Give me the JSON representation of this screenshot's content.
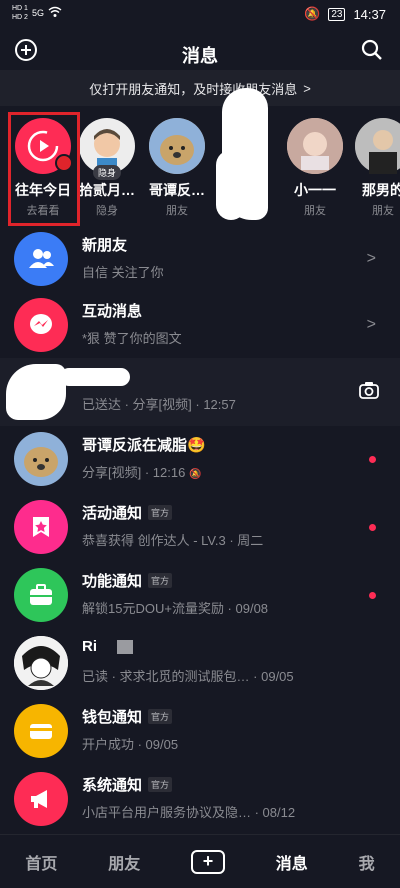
{
  "status_bar": {
    "network_left": [
      "HD 1",
      "HD 2"
    ],
    "signal": "5G",
    "time": "14:37",
    "battery": "23"
  },
  "header": {
    "title": "消息",
    "add_icon": "plus-circle-icon",
    "search_icon": "search-icon"
  },
  "banner": {
    "text": "仅打开朋友通知，及时接收朋友消息",
    "chevron": ">"
  },
  "stories": [
    {
      "name": "往年今日",
      "sub": "去看看",
      "avatar_color": "#fe2c55"
    },
    {
      "name": "拾贰月…",
      "sub": "隐身",
      "tag": "隐身",
      "avatar_color": "#ededed"
    },
    {
      "name": "哥谭反…",
      "sub": "朋友",
      "avatar_color": "#b99a6f"
    },
    {
      "name": "",
      "sub": "",
      "avatar_color": "#ffffff"
    },
    {
      "name": "小一一",
      "sub": "朋友",
      "avatar_color": "#d9b7b0"
    },
    {
      "name": "那男的",
      "sub": "朋友",
      "avatar_color": "#3a3a3a"
    }
  ],
  "list": [
    {
      "title": "新朋友",
      "subtitle": "自信 关注了你",
      "right": ">",
      "icon": "people-icon",
      "color": "#3b7cf6"
    },
    {
      "title": "互动消息",
      "subtitle": "*狠 赞了你的图文",
      "right": ">",
      "icon": "chat-bolt-icon",
      "color": "#fe2c55"
    },
    {
      "title": "",
      "subtitle": "已送达 · 分享[视频] · 12:57",
      "right": "camera",
      "icon": "redacted",
      "color": "#ffffff"
    },
    {
      "title": "哥谭反派在减脂🤩",
      "subtitle": "分享[视频] · 12:16",
      "right": "dot",
      "icon": "dog-avatar",
      "color": "#b99a6f"
    },
    {
      "title": "活动通知",
      "subtitle": "恭喜获得  创作达人 - LV.3 · 周二",
      "official": "官方",
      "right": "dot",
      "icon": "star-bookmark-icon",
      "color": "#fe2c8d"
    },
    {
      "title": "功能通知",
      "subtitle": "解锁15元DOU+流量奖励 · 09/08",
      "official": "官方",
      "right": "dot",
      "icon": "briefcase-icon",
      "color": "#2ec65a"
    },
    {
      "title": "Ri",
      "subtitle": "已读 · 求求北觅的测试服包… · 09/05",
      "right": "",
      "icon": "anime-avatar",
      "color": "#ffffff"
    },
    {
      "title": "钱包通知",
      "subtitle": "开户成功 · 09/05",
      "official": "官方",
      "right": "",
      "icon": "wallet-icon",
      "color": "#f7b500"
    },
    {
      "title": "系统通知",
      "subtitle": "小店平台用户服务协议及隐… · 08/12",
      "official": "官方",
      "right": "",
      "icon": "megaphone-icon",
      "color": "#fe2c55"
    }
  ],
  "bottom_nav": {
    "home": "首页",
    "friends": "朋友",
    "plus": "+",
    "messages": "消息",
    "me": "我"
  }
}
